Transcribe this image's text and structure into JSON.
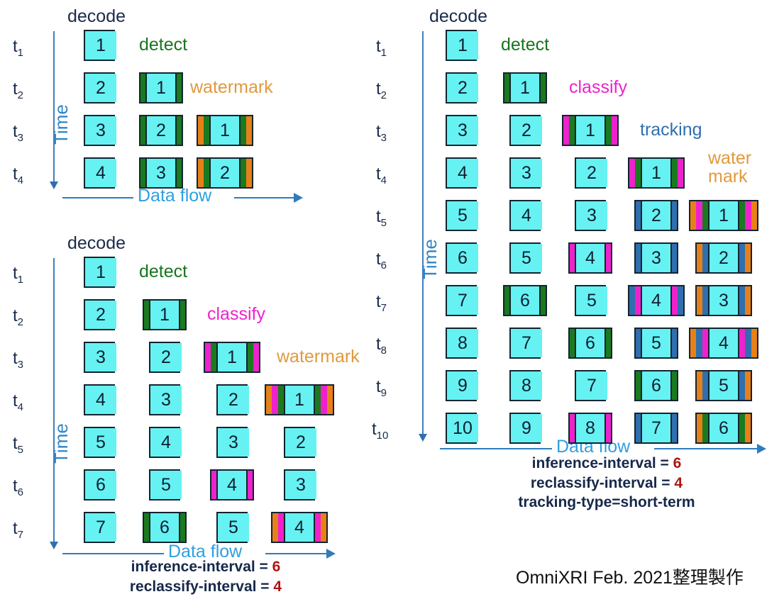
{
  "colors": {
    "frame_fill": "#66f2f2",
    "frame_border": "#12242f",
    "decode": "#1a2b4a",
    "detect": "#1a7a1f",
    "classify": "#ee22cc",
    "tracking": "#2f6fae",
    "watermark": "#e8801a",
    "axis": "#2f7cbd",
    "time_label": "#2f86c8",
    "flow_label": "#2f9fe0",
    "note_number": "#b01414"
  },
  "stage_colors": {
    "detect": "#1a7a1f",
    "classify": "#ee22cc",
    "tracking": "#2f6fae",
    "watermark": "#e8801a"
  },
  "time_axis_label": "Time",
  "flow_label": "Data flow",
  "credit": "OmniXRI Feb. 2021整理製作",
  "panels": [
    {
      "id": "top-left",
      "captions": [
        {
          "text": "decode",
          "kind": "decode"
        },
        {
          "text": "detect",
          "kind": "detect"
        },
        {
          "text": "watermark",
          "kind": "watermark"
        }
      ],
      "ticks": [
        "t1",
        "t2",
        "t3",
        "t4"
      ],
      "columns": [
        "decode",
        "detect",
        "watermark"
      ],
      "rows": [
        [
          {
            "n": 1,
            "layers": []
          },
          null,
          null
        ],
        [
          {
            "n": 2,
            "layers": []
          },
          {
            "n": 1,
            "layers": [
              "detect"
            ]
          },
          null
        ],
        [
          {
            "n": 3,
            "layers": []
          },
          {
            "n": 2,
            "layers": [
              "detect"
            ]
          },
          {
            "n": 1,
            "layers": [
              "watermark",
              "detect"
            ]
          }
        ],
        [
          {
            "n": 4,
            "layers": []
          },
          {
            "n": 3,
            "layers": [
              "detect"
            ]
          },
          {
            "n": 2,
            "layers": [
              "watermark",
              "detect"
            ]
          }
        ]
      ],
      "note": []
    },
    {
      "id": "bottom-left",
      "captions": [
        {
          "text": "decode",
          "kind": "decode"
        },
        {
          "text": "detect",
          "kind": "detect"
        },
        {
          "text": "classify",
          "kind": "classify"
        },
        {
          "text": "watermark",
          "kind": "watermark"
        }
      ],
      "ticks": [
        "t1",
        "t2",
        "t3",
        "t4",
        "t5",
        "t6",
        "t7"
      ],
      "columns": [
        "decode",
        "detect",
        "classify",
        "watermark"
      ],
      "rows": [
        [
          {
            "n": 1,
            "layers": []
          },
          null,
          null,
          null
        ],
        [
          {
            "n": 2,
            "layers": []
          },
          {
            "n": 1,
            "layers": [
              "detect"
            ]
          },
          null,
          null
        ],
        [
          {
            "n": 3,
            "layers": []
          },
          {
            "n": 2,
            "layers": []
          },
          {
            "n": 1,
            "layers": [
              "classify",
              "detect"
            ]
          },
          null
        ],
        [
          {
            "n": 4,
            "layers": []
          },
          {
            "n": 3,
            "layers": []
          },
          {
            "n": 2,
            "layers": []
          },
          {
            "n": 1,
            "layers": [
              "watermark",
              "classify",
              "detect"
            ]
          }
        ],
        [
          {
            "n": 5,
            "layers": []
          },
          {
            "n": 4,
            "layers": []
          },
          {
            "n": 3,
            "layers": []
          },
          {
            "n": 2,
            "layers": []
          }
        ],
        [
          {
            "n": 6,
            "layers": []
          },
          {
            "n": 5,
            "layers": []
          },
          {
            "n": 4,
            "layers": [
              "classify"
            ]
          },
          {
            "n": 3,
            "layers": []
          }
        ],
        [
          {
            "n": 7,
            "layers": []
          },
          {
            "n": 6,
            "layers": [
              "detect"
            ]
          },
          {
            "n": 5,
            "layers": []
          },
          {
            "n": 4,
            "layers": [
              "watermark",
              "classify"
            ]
          }
        ]
      ],
      "note": [
        {
          "label": "inference-interval = ",
          "value": "6"
        },
        {
          "label": "reclassify-interval = ",
          "value": "4"
        }
      ]
    },
    {
      "id": "right",
      "captions": [
        {
          "text": "decode",
          "kind": "decode"
        },
        {
          "text": "detect",
          "kind": "detect"
        },
        {
          "text": "classify",
          "kind": "classify"
        },
        {
          "text": "tracking",
          "kind": "tracking"
        },
        {
          "text": "water\nmark",
          "kind": "watermark"
        }
      ],
      "ticks": [
        "t1",
        "t2",
        "t3",
        "t4",
        "t5",
        "t6",
        "t7",
        "t8",
        "t9",
        "t10"
      ],
      "columns": [
        "decode",
        "detect",
        "classify",
        "tracking",
        "watermark"
      ],
      "rows": [
        [
          {
            "n": 1,
            "layers": []
          },
          null,
          null,
          null,
          null
        ],
        [
          {
            "n": 2,
            "layers": []
          },
          {
            "n": 1,
            "layers": [
              "detect"
            ]
          },
          null,
          null,
          null
        ],
        [
          {
            "n": 3,
            "layers": []
          },
          {
            "n": 2,
            "layers": []
          },
          {
            "n": 1,
            "layers": [
              "classify",
              "detect"
            ]
          },
          null,
          null
        ],
        [
          {
            "n": 4,
            "layers": []
          },
          {
            "n": 3,
            "layers": []
          },
          {
            "n": 2,
            "layers": []
          },
          {
            "n": 1,
            "layers": [
              "classify",
              "detect"
            ]
          },
          null
        ],
        [
          {
            "n": 5,
            "layers": []
          },
          {
            "n": 4,
            "layers": []
          },
          {
            "n": 3,
            "layers": []
          },
          {
            "n": 2,
            "layers": [
              "tracking"
            ]
          },
          {
            "n": 1,
            "layers": [
              "watermark",
              "classify",
              "detect"
            ]
          }
        ],
        [
          {
            "n": 6,
            "layers": []
          },
          {
            "n": 5,
            "layers": []
          },
          {
            "n": 4,
            "layers": [
              "classify"
            ]
          },
          {
            "n": 3,
            "layers": [
              "tracking"
            ]
          },
          {
            "n": 2,
            "layers": [
              "watermark",
              "tracking"
            ]
          }
        ],
        [
          {
            "n": 7,
            "layers": []
          },
          {
            "n": 6,
            "layers": [
              "detect"
            ]
          },
          {
            "n": 5,
            "layers": []
          },
          {
            "n": 4,
            "layers": [
              "tracking",
              "classify"
            ]
          },
          {
            "n": 3,
            "layers": [
              "watermark",
              "tracking"
            ]
          }
        ],
        [
          {
            "n": 8,
            "layers": []
          },
          {
            "n": 7,
            "layers": []
          },
          {
            "n": 6,
            "layers": [
              "detect"
            ]
          },
          {
            "n": 5,
            "layers": [
              "tracking"
            ]
          },
          {
            "n": 4,
            "layers": [
              "watermark",
              "tracking",
              "classify"
            ]
          }
        ],
        [
          {
            "n": 9,
            "layers": []
          },
          {
            "n": 8,
            "layers": []
          },
          {
            "n": 7,
            "layers": []
          },
          {
            "n": 6,
            "layers": [
              "detect"
            ]
          },
          {
            "n": 5,
            "layers": [
              "watermark",
              "tracking"
            ]
          }
        ],
        [
          {
            "n": 10,
            "layers": []
          },
          {
            "n": 9,
            "layers": []
          },
          {
            "n": 8,
            "layers": [
              "classify"
            ]
          },
          {
            "n": 7,
            "layers": [
              "tracking"
            ]
          },
          {
            "n": 6,
            "layers": [
              "watermark",
              "detect"
            ]
          }
        ]
      ],
      "note": [
        {
          "label": "inference-interval = ",
          "value": "6"
        },
        {
          "label": "reclassify-interval = ",
          "value": "4"
        },
        {
          "label": "tracking-type=short-term",
          "value": ""
        }
      ]
    }
  ]
}
